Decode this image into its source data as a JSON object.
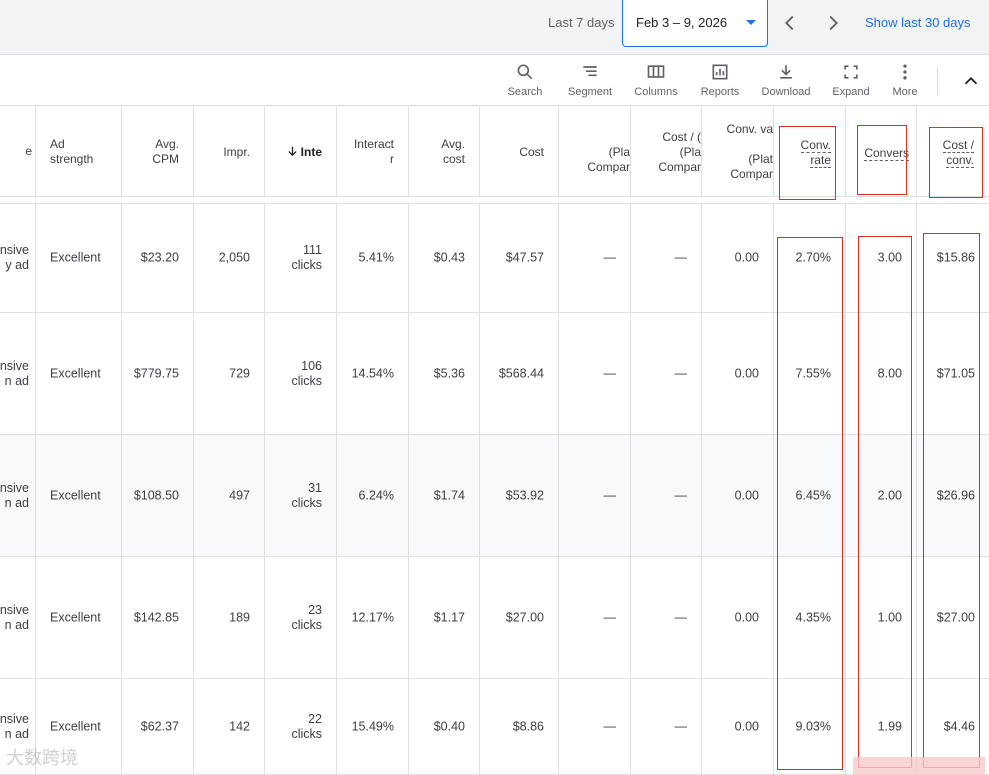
{
  "datebar": {
    "range_label": "Last 7 days",
    "date_value": "Feb 3 – 9, 2026",
    "prev_icon": "chevron-left-icon",
    "next_icon": "chevron-right-icon",
    "show_last_30": "Show last 30 days",
    "accent_color": "#1a73e8"
  },
  "toolbar": {
    "search": "Search",
    "segment": "Segment",
    "columns": "Columns",
    "reports": "Reports",
    "download": "Download",
    "expand": "Expand",
    "more": "More"
  },
  "table": {
    "headers": {
      "col0": "e",
      "ad_strength_1": "Ad",
      "ad_strength_2": "strength",
      "avg_cpm_1": "Avg.",
      "avg_cpm_2": "CPM",
      "impr": "Impr.",
      "interactions": "Inte",
      "interaction_rate_1": "Interact",
      "interaction_rate_2": "r",
      "avg_cost_1": "Avg.",
      "avg_cost_2": "cost",
      "cost": "Cost",
      "plat_1": "(Pla",
      "plat_2": "Compar",
      "cost_plat_1": "Cost / (",
      "cost_plat_2": "(Pla",
      "cost_plat_3": "Compar",
      "conv_val_1": "Conv. va",
      "conv_val_2": "(Plat",
      "conv_val_3": "Compar",
      "conv_rate_1": "Conv.",
      "conv_rate_2": "rate",
      "conversions": "Convers",
      "cost_conv_1": "Cost /",
      "cost_conv_2": "conv."
    },
    "rows": [
      {
        "name_1": "nsive",
        "name_2": "y ad",
        "ad_strength": "Excellent",
        "avg_cpm": "$23.20",
        "impr": "2,050",
        "int_1": "111",
        "int_2": "clicks",
        "int_rate": "5.41%",
        "avg_cost": "$0.43",
        "cost": "$47.57",
        "plat": "—",
        "cost_plat": "—",
        "conv_val": "0.00",
        "conv_rate": "2.70%",
        "conversions": "3.00",
        "cost_conv": "$15.86"
      },
      {
        "name_1": "nsive",
        "name_2": "n ad",
        "ad_strength": "Excellent",
        "avg_cpm": "$779.75",
        "impr": "729",
        "int_1": "106",
        "int_2": "clicks",
        "int_rate": "14.54%",
        "avg_cost": "$5.36",
        "cost": "$568.44",
        "plat": "—",
        "cost_plat": "—",
        "conv_val": "0.00",
        "conv_rate": "7.55%",
        "conversions": "8.00",
        "cost_conv": "$71.05"
      },
      {
        "name_1": "nsive",
        "name_2": "n ad",
        "ad_strength": "Excellent",
        "avg_cpm": "$108.50",
        "impr": "497",
        "int_1": "31",
        "int_2": "clicks",
        "int_rate": "6.24%",
        "avg_cost": "$1.74",
        "cost": "$53.92",
        "plat": "—",
        "cost_plat": "—",
        "conv_val": "0.00",
        "conv_rate": "6.45%",
        "conversions": "2.00",
        "cost_conv": "$26.96"
      },
      {
        "name_1": "nsive",
        "name_2": "n ad",
        "ad_strength": "Excellent",
        "avg_cpm": "$142.85",
        "impr": "189",
        "int_1": "23",
        "int_2": "clicks",
        "int_rate": "12.17%",
        "avg_cost": "$1.17",
        "cost": "$27.00",
        "plat": "—",
        "cost_plat": "—",
        "conv_val": "0.00",
        "conv_rate": "4.35%",
        "conversions": "1.00",
        "cost_conv": "$27.00"
      },
      {
        "name_1": "nsive",
        "name_2": "n ad",
        "ad_strength": "Excellent",
        "avg_cpm": "$62.37",
        "impr": "142",
        "int_1": "22",
        "int_2": "clicks",
        "int_rate": "15.49%",
        "avg_cost": "$0.40",
        "cost": "$8.86",
        "plat": "—",
        "cost_plat": "—",
        "conv_val": "0.00",
        "conv_rate": "9.03%",
        "conversions": "1.99",
        "cost_conv": "$4.46"
      }
    ]
  },
  "watermark": "大数跨境",
  "annotation_color": "#d93025"
}
